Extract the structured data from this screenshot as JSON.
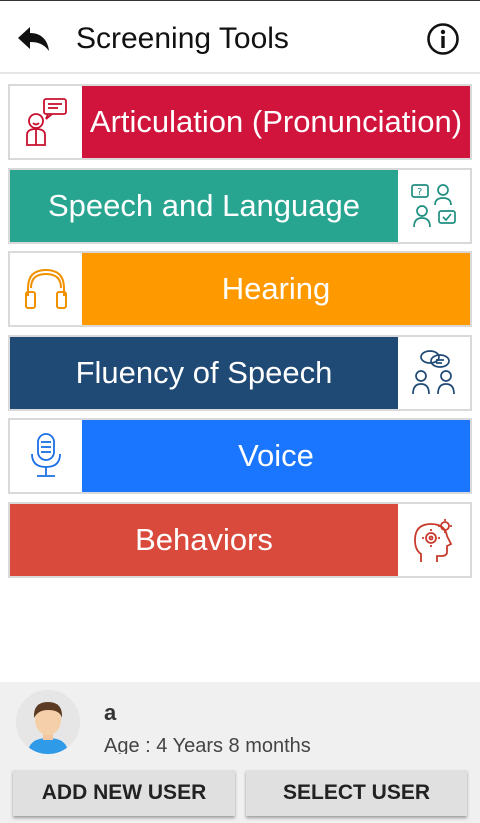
{
  "header": {
    "title": "Screening Tools",
    "back_icon": "back-arrow-icon",
    "info_icon": "info-icon"
  },
  "tools": [
    {
      "label": "Articulation (Pronunciation)",
      "color": "#d0143c",
      "icon": "speaking-person-icon"
    },
    {
      "label": "Speech and Language",
      "color": "#27a591",
      "icon": "conversation-people-icon"
    },
    {
      "label": "Hearing",
      "color": "#ff9900",
      "icon": "headphones-icon"
    },
    {
      "label": "Fluency of Speech",
      "color": "#1f4a75",
      "icon": "dialogue-people-icon"
    },
    {
      "label": "Voice",
      "color": "#1a75ff",
      "icon": "microphone-icon"
    },
    {
      "label": "Behaviors",
      "color": "#d94a3c",
      "icon": "head-gears-icon"
    }
  ],
  "user": {
    "name": "a",
    "age": "Age : 4 Years  8 months",
    "avatar_icon": "avatar-boy-icon"
  },
  "buttons": {
    "add_user": "ADD NEW USER",
    "select_user": "SELECT USER"
  }
}
